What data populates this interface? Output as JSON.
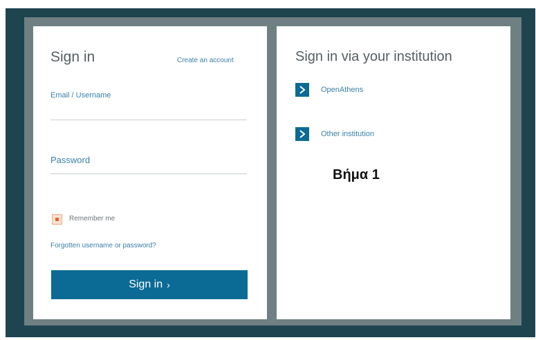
{
  "signin": {
    "title": "Sign in",
    "create_account": "Create an account",
    "email_label": "Email / Username",
    "email_value": "",
    "password_label": "Password",
    "password_value": "",
    "remember_label": "Remember me",
    "remember_checked": true,
    "forgot_link": "Forgotten username or password?",
    "button_label": "Sign in",
    "button_chevron": "›"
  },
  "institution": {
    "title": "Sign in via your institution",
    "items": [
      {
        "label": "OpenAthens",
        "icon": "chevron-right-icon"
      },
      {
        "label": "Other institution",
        "icon": "chevron-right-icon"
      }
    ]
  },
  "annotation": {
    "step": "Βήμα 1"
  },
  "colors": {
    "outer_border": "#1e4450",
    "inner_frame": "#6f8082",
    "accent_blue": "#0c6b95",
    "link_blue": "#3a7fa8",
    "checkbox_orange": "#e8632c"
  }
}
